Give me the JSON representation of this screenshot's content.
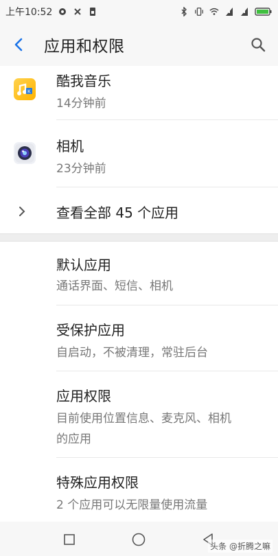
{
  "status_bar": {
    "time": "上午10:52",
    "battery_color": "#3fbf3f"
  },
  "header": {
    "title": "应用和权限"
  },
  "recent_apps": [
    {
      "name": "酷我音乐",
      "time": "14分钟前"
    },
    {
      "name": "相机",
      "time": "23分钟前"
    }
  ],
  "view_all": {
    "label": "查看全部 45 个应用"
  },
  "settings": [
    {
      "title": "默认应用",
      "subtitle": "通话界面、短信、相机"
    },
    {
      "title": "受保护应用",
      "subtitle": "自启动，不被清理，常驻后台"
    },
    {
      "title": "应用权限",
      "subtitle_line1": "目前使用位置信息、麦克风、相机",
      "subtitle_line2": "的应用"
    },
    {
      "title": "特殊应用权限",
      "subtitle": "2 个应用可以无限量使用流量"
    }
  ],
  "watermark": "头条 @折腾之嘛",
  "colors": {
    "accent": "#1a73e8",
    "text": "#222222",
    "secondary": "#777777"
  }
}
